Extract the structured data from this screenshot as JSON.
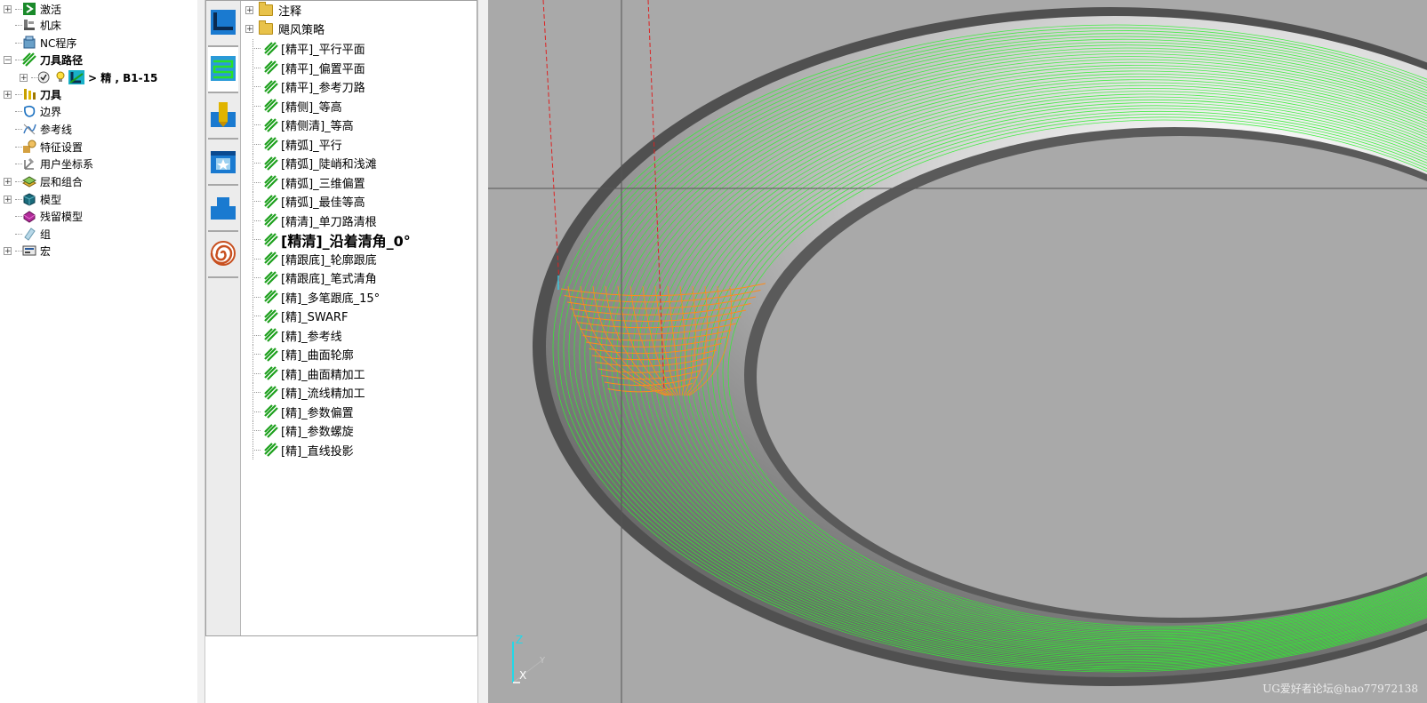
{
  "explorer": {
    "items": [
      {
        "label": "激活",
        "expander": "+",
        "icon": "activate-icon",
        "bold": false
      },
      {
        "label": "机床",
        "expander": "",
        "icon": "machine-icon",
        "bold": false
      },
      {
        "label": "NC程序",
        "expander": "",
        "icon": "nc-program-icon",
        "bold": false
      },
      {
        "label": "刀具路径",
        "expander": "-",
        "icon": "toolpath-icon",
        "bold": true
      },
      {
        "label": "> 精 , B1-15",
        "expander": "+",
        "icon": "toolpath-status-icon",
        "bold": true
      },
      {
        "label": "刀具",
        "expander": "+",
        "icon": "tool-icon",
        "bold": true
      },
      {
        "label": "边界",
        "expander": "",
        "icon": "boundary-icon",
        "bold": false
      },
      {
        "label": "参考线",
        "expander": "",
        "icon": "pattern-icon",
        "bold": false
      },
      {
        "label": "特征设置",
        "expander": "",
        "icon": "feature-set-icon",
        "bold": false
      },
      {
        "label": "用户坐标系",
        "expander": "",
        "icon": "workplane-icon",
        "bold": false
      },
      {
        "label": "层和组合",
        "expander": "+",
        "icon": "layers-icon",
        "bold": false
      },
      {
        "label": "模型",
        "expander": "+",
        "icon": "model-icon",
        "bold": false
      },
      {
        "label": "残留模型",
        "expander": "",
        "icon": "stock-model-icon",
        "bold": false
      },
      {
        "label": "组",
        "expander": "",
        "icon": "group-icon",
        "bold": false
      },
      {
        "label": "宏",
        "expander": "+",
        "icon": "macro-icon",
        "bold": false
      }
    ]
  },
  "strategy": {
    "tabs": [
      "area-clearance-icon",
      "finishing-icon",
      "drilling-icon",
      "feature-icon",
      "rest-icon",
      "spiral-icon"
    ],
    "active_tab": 1,
    "folders": [
      "注释",
      "飓风策略"
    ],
    "items": [
      "[精平]_平行平面",
      "[精平]_偏置平面",
      "[精平]_参考刀路",
      "[精侧]_等高",
      "[精侧清]_等高",
      "[精弧]_平行",
      "[精弧]_陡峭和浅滩",
      "[精弧]_三维偏置",
      "[精弧]_最佳等高",
      "[精清]_单刀路清根",
      "[精清]_沿着清角_0°",
      "[精跟底]_轮廓跟底",
      "[精跟底]_笔式清角",
      "[精]_多笔跟底_15°",
      "[精]_SWARF",
      "[精]_参考线",
      "[精]_曲面轮廓",
      "[精]_曲面精加工",
      "[精]_流线精加工",
      "[精]_参数偏置",
      "[精]_参数螺旋",
      "[精]_直线投影"
    ],
    "highlighted_index": 10
  },
  "viewport": {
    "axis_z": "Z",
    "axis_y": "Y",
    "axis_x": "X",
    "watermark": "UG爱好者论坛@hao77972138",
    "colors": {
      "background": "#a9a9a9",
      "toolpath": "#33ee33",
      "active_toolpath": "#ff8c1a",
      "surface_dark": "#505050",
      "crosshair": "#555555",
      "guide_line": "#dd2222"
    }
  }
}
